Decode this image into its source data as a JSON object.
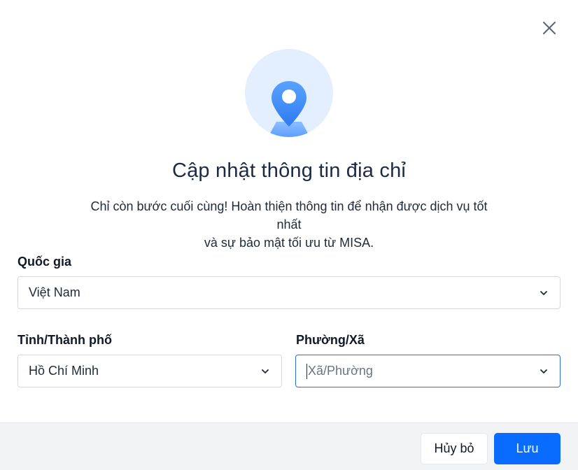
{
  "dialog": {
    "title": "Cập nhật thông tin địa chỉ",
    "subtitle_line1": "Chỉ còn bước cuối cùng! Hoàn thiện thông tin để nhận được dịch vụ tốt nhất",
    "subtitle_line2": "và sự bảo mật tối ưu từ MISA.",
    "icons": {
      "close": "close-icon",
      "hero": "map-pin-icon",
      "dropdown": "chevron-down-icon"
    }
  },
  "form": {
    "country": {
      "label": "Quốc gia",
      "value": "Việt Nam"
    },
    "province": {
      "label": "Tỉnh/Thành phố",
      "value": "Hồ Chí Minh"
    },
    "ward": {
      "label": "Phường/Xã",
      "value": "",
      "placeholder": "Xã/Phường"
    }
  },
  "footer": {
    "cancel_label": "Hủy bỏ",
    "save_label": "Lưu"
  },
  "colors": {
    "primary": "#0a6cff",
    "hero_bg": "#e3efff",
    "pin": "#3b82f6",
    "focus_border": "#2b6fd6"
  }
}
